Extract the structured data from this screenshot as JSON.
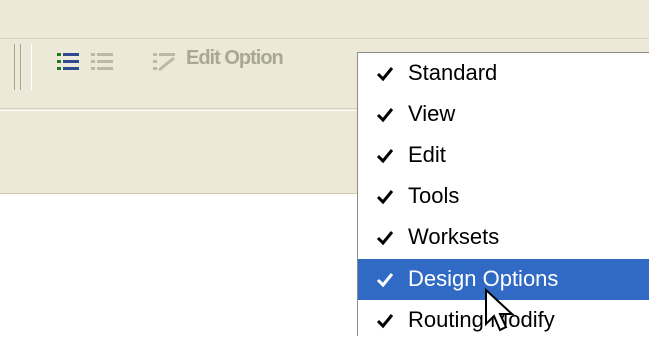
{
  "toolbar": {
    "edit_option_label": "Edit Option",
    "icons": [
      "list-icon",
      "list-bullets-icon",
      "list-edit-icon"
    ]
  },
  "menu": {
    "items": [
      {
        "label": "Standard",
        "checked": true,
        "highlighted": false
      },
      {
        "label": "View",
        "checked": true,
        "highlighted": false
      },
      {
        "label": "Edit",
        "checked": true,
        "highlighted": false
      },
      {
        "label": "Tools",
        "checked": true,
        "highlighted": false
      },
      {
        "label": "Worksets",
        "checked": true,
        "highlighted": false
      },
      {
        "label": "Design Options",
        "checked": true,
        "highlighted": true
      },
      {
        "label": "Routing Modify",
        "checked": true,
        "highlighted": false
      }
    ]
  },
  "colors": {
    "toolbar_bg": "#ece9d8",
    "highlight": "#316ac5",
    "menu_bg": "#ffffff"
  }
}
